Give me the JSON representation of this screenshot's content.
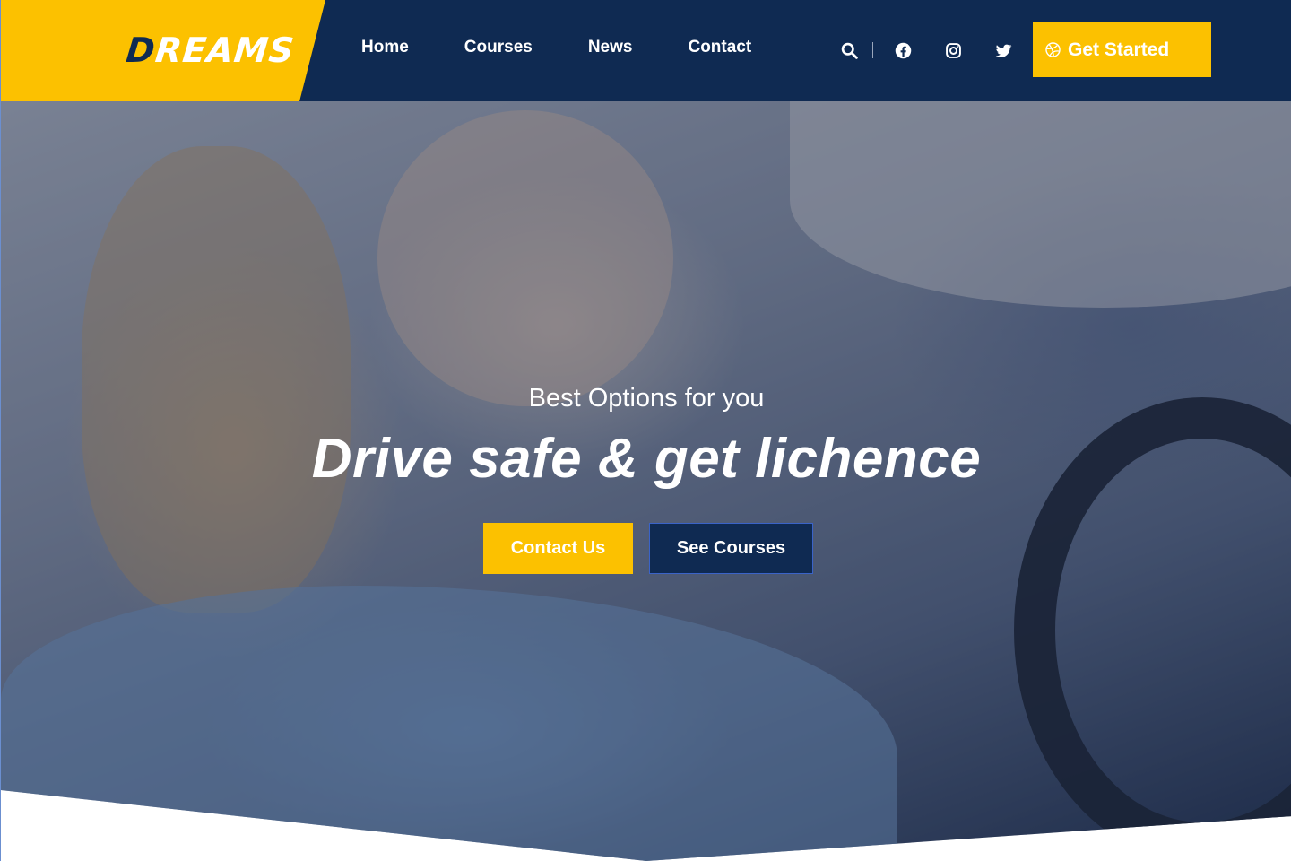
{
  "brand": {
    "logo_first": "D",
    "logo_rest": "REAMS"
  },
  "nav": {
    "items": [
      {
        "label": "Home"
      },
      {
        "label": "Courses"
      },
      {
        "label": "News"
      },
      {
        "label": "Contact"
      }
    ]
  },
  "header_icons": [
    "search-icon",
    "facebook-icon",
    "instagram-icon",
    "twitter-icon"
  ],
  "cta": {
    "get_started": "Get Started",
    "get_started_icon": "dribbble-icon"
  },
  "hero": {
    "subtitle": "Best Options for you",
    "title": "Drive safe & get lichence",
    "contact_label": "Contact Us",
    "courses_label": "See Courses"
  },
  "colors": {
    "accent": "#fcc100",
    "navy": "#0f2a52",
    "white": "#ffffff"
  }
}
